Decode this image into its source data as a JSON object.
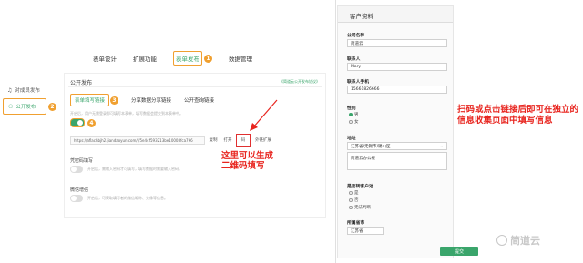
{
  "top_nav": {
    "items": [
      "表单设计",
      "扩展功能",
      "表单发布",
      "数据管理"
    ],
    "active_badge": "1"
  },
  "sidebar": {
    "items": [
      {
        "label": "对成员发布"
      },
      {
        "label": "公开发布",
        "badge": "2"
      }
    ]
  },
  "publish": {
    "title": "公开发布",
    "right_link": "《简道云公开发布协议》",
    "tabs": [
      "表单填写链接",
      "分享数据分享链接",
      "公开查询链接"
    ],
    "tab_badge": "3",
    "hint": "开启后，用户无需登录即可填写本表单，填写数据会提交到本表单中。",
    "toggle_badge": "4",
    "link": "https://aflachbjh2.jiandaoyun.com/f/5e44f593213be10008fca796",
    "buttons": [
      "复制",
      "打开",
      "二维码",
      "外链扩展"
    ],
    "qr_label": "码",
    "sections": [
      {
        "title": "凭密码填写",
        "hint": "开启后，需输入密码才可填写，填写数据时需要输入密码。"
      },
      {
        "title": "微信增强",
        "hint": "开启后，可获取填写者的微信昵称、头像等信息。"
      }
    ],
    "annotation": "这里可以生成\n二维码填写"
  },
  "form": {
    "header": "客户资料",
    "fields": [
      {
        "label": "公司名称",
        "value": "简道云"
      },
      {
        "label": "联系人",
        "value": "Mary"
      },
      {
        "label": "联系人手机",
        "value": "15661826666"
      }
    ],
    "gender": {
      "label": "性别",
      "options": [
        "男",
        "女"
      ]
    },
    "address": {
      "label": "地址",
      "region": "江苏省/无锡市/锡山区",
      "detail": "简道云办公楼"
    },
    "existing": {
      "label": "是否转客户池",
      "options": [
        "是",
        "否",
        "无法判断"
      ]
    },
    "city": {
      "label": "所属省市",
      "value": "江苏省"
    },
    "submit": "提交"
  },
  "tip": "扫码或点击链接后即可在独立的信息收集页面中填写信息",
  "watermark": "简道云",
  "colors": {
    "accent": "#3aa56b",
    "highlight": "#f0a030",
    "annotation": "#e8251f"
  }
}
